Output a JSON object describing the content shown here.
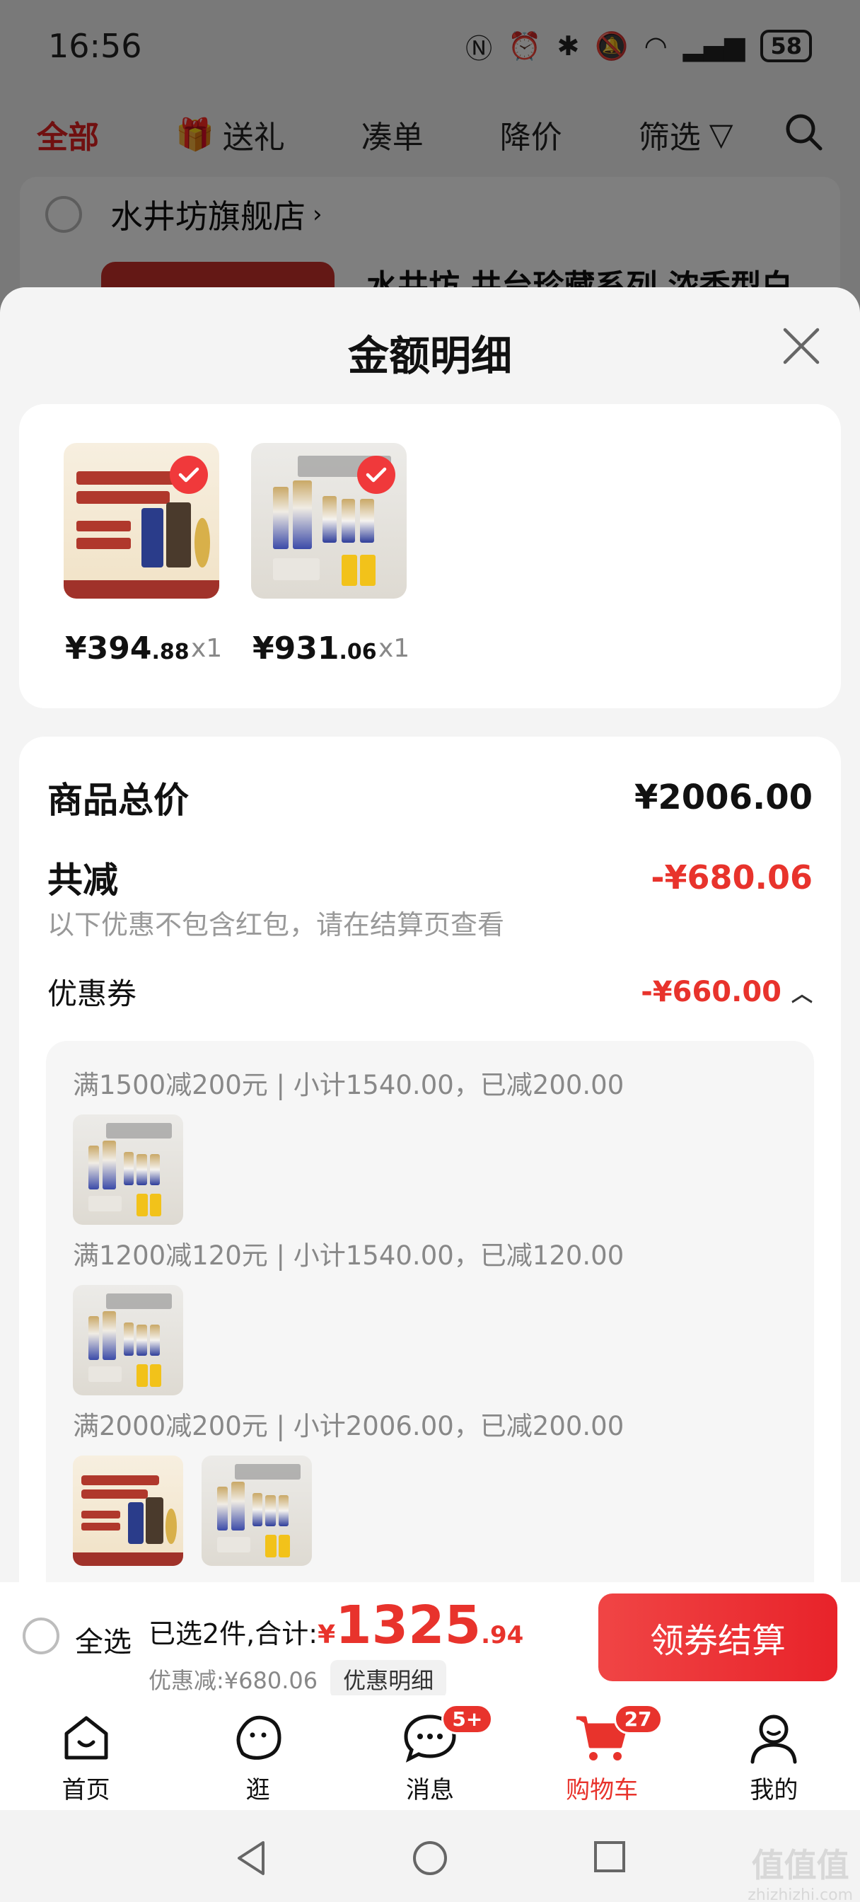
{
  "status_bar": {
    "time": "16:56",
    "battery": "58"
  },
  "bg_tabs": [
    "全部",
    "送礼",
    "凑单",
    "降价",
    "筛选"
  ],
  "bg_store": {
    "name": "水井坊旗舰店",
    "product_title": "水井坊 井台珍藏系列 浓香型白"
  },
  "sheet": {
    "title": "金额明细",
    "items": [
      {
        "price_int": "¥394",
        "price_dec": ".88",
        "qty": "x1",
        "image": "liquor-product"
      },
      {
        "price_int": "¥931",
        "price_dec": ".06",
        "qty": "x1",
        "image": "cosmetics-product"
      }
    ],
    "total_label": "商品总价",
    "total_value": "¥2006.00",
    "discount_label": "共减",
    "discount_value": "-¥680.06",
    "discount_note": "以下优惠不包含红包，请在结算页查看",
    "coupon_label": "优惠券",
    "coupon_value": "-¥660.00",
    "coupon_groups": [
      {
        "text": "满1500减200元 | 小计1540.00，已减200.00",
        "images": [
          "cosmetics-product"
        ]
      },
      {
        "text": "满1200减120元 | 小计1540.00，已减120.00",
        "images": [
          "cosmetics-product"
        ]
      },
      {
        "text": "满2000减200元 | 小计2006.00，已减200.00",
        "images": [
          "liquor-product",
          "cosmetics-product"
        ]
      }
    ]
  },
  "checkout": {
    "select_all": "全选",
    "selected_text": "已选2件,合计:",
    "yen": "¥",
    "total_int": "1325",
    "total_dec": ".94",
    "discount_text": "优惠减:¥680.06",
    "detail_chip": "优惠明细",
    "button": "领券结算"
  },
  "tabbar": [
    {
      "label": "首页",
      "icon": "home-icon"
    },
    {
      "label": "逛",
      "icon": "browse-icon"
    },
    {
      "label": "消息",
      "icon": "message-icon",
      "badge": "5+"
    },
    {
      "label": "购物车",
      "icon": "cart-icon",
      "badge": "27",
      "active": true
    },
    {
      "label": "我的",
      "icon": "profile-icon"
    }
  ],
  "colors": {
    "accent": "#e8332c",
    "check": "#f0393b"
  },
  "watermark": {
    "glyphs": "值值值",
    "domain": "zhizhizhi.com"
  }
}
